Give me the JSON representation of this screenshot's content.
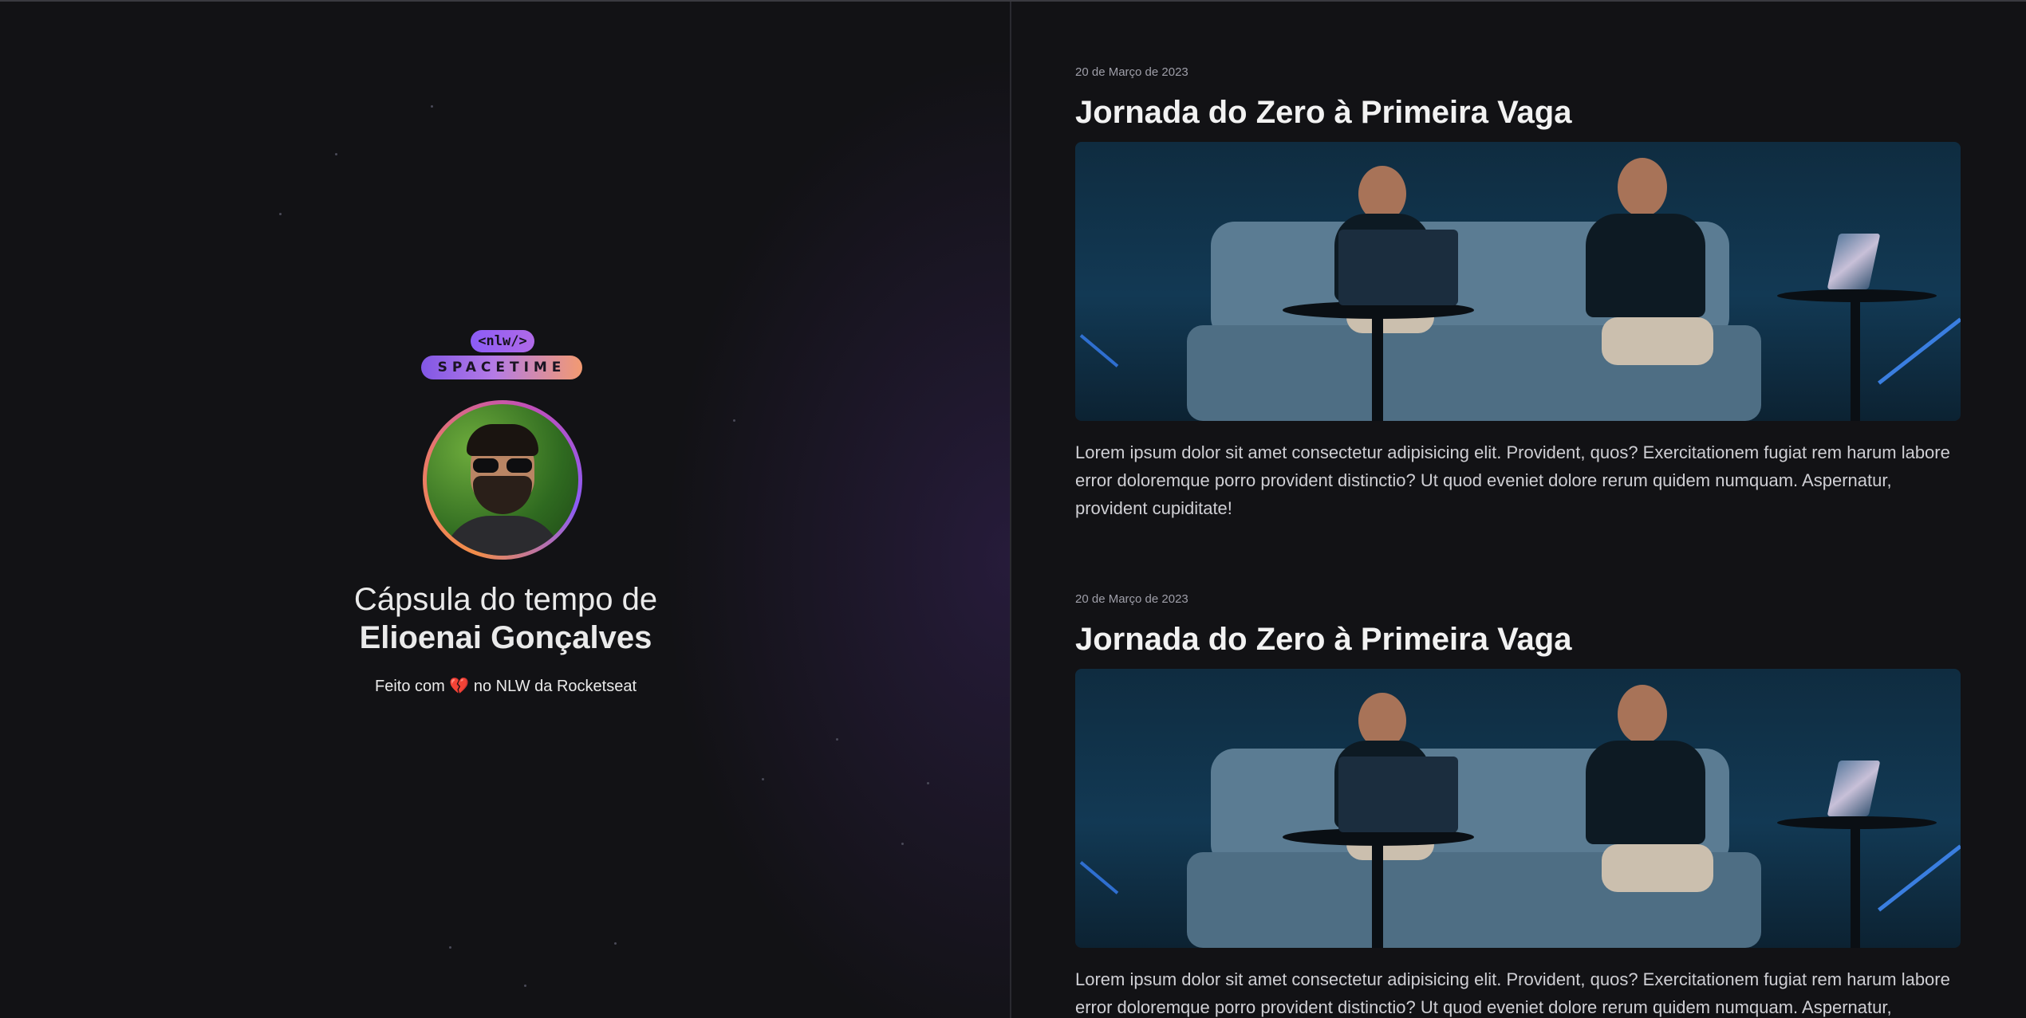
{
  "brand": {
    "logo_tag": "<nlw/>",
    "logo_word": "SPACETIME"
  },
  "profile": {
    "title_prefix": "Cápsula do tempo de",
    "name": "Elioenai Gonçalves",
    "credit_before": "Feito com",
    "credit_heart": "💔",
    "credit_after": "no NLW da Rocketseat"
  },
  "memories": [
    {
      "date": "20 de Março de 2023",
      "title": "Jornada do Zero à Primeira Vaga",
      "text": "Lorem ipsum dolor sit amet consectetur adipisicing elit. Provident, quos? Exercitationem fugiat rem harum labore error doloremque porro provident distinctio? Ut quod eveniet dolore rerum quidem numquam. Aspernatur, provident cupiditate!"
    },
    {
      "date": "20 de Março de 2023",
      "title": "Jornada do Zero à Primeira Vaga",
      "text": "Lorem ipsum dolor sit amet consectetur adipisicing elit. Provident, quos? Exercitationem fugiat rem harum labore error doloremque porro provident distinctio? Ut quod eveniet dolore rerum quidem numquam. Aspernatur, provident cupiditate!"
    }
  ],
  "colors": {
    "background": "#121215",
    "accent_purple": "#8257e5",
    "accent_orange": "#f29a71"
  }
}
